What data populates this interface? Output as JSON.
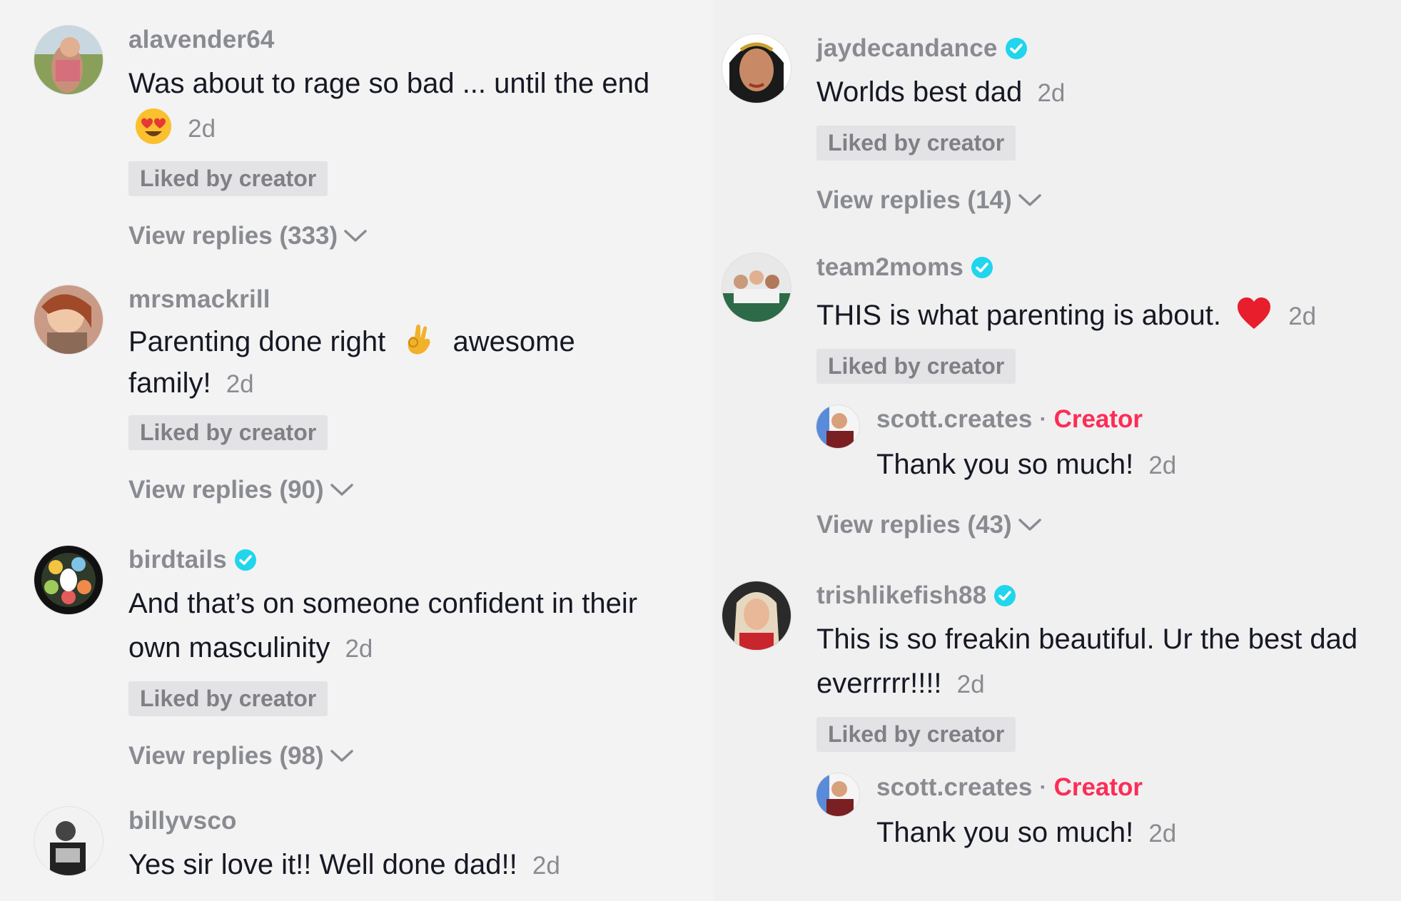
{
  "colors": {
    "verified": "#20d5ec",
    "creator_red": "#fe2c55",
    "muted": "#8a8b91"
  },
  "left": [
    {
      "username": "alavender64",
      "verified": false,
      "text": "Was about to rage so bad ... until the end",
      "emoji": "heart-eyes-emoji",
      "time": "2d",
      "liked": "Liked by creator",
      "replies": "View replies (333)"
    },
    {
      "username": "mrsmackrill",
      "verified": false,
      "text_before": "Parenting done right",
      "emoji": "ok-hand-emoji",
      "text_after": "awesome family!",
      "time": "2d",
      "liked": "Liked by creator",
      "replies": "View replies (90)"
    },
    {
      "username": "birdtails",
      "verified": true,
      "text": "And that’s on someone confident in their own masculinity",
      "time": "2d",
      "liked": "Liked by creator",
      "replies": "View replies (98)"
    },
    {
      "username": "billyvsco",
      "verified": false,
      "text": "Yes sir love it!! Well done dad!!",
      "time": "2d"
    }
  ],
  "right": [
    {
      "username": "jaydecandance",
      "verified": true,
      "text": "Worlds best dad",
      "time": "2d",
      "liked": "Liked by creator",
      "replies": "View replies (14)"
    },
    {
      "username": "team2moms",
      "verified": true,
      "text": "THIS is what parenting is about.",
      "emoji": "red-heart-emoji",
      "time": "2d",
      "liked": "Liked by creator",
      "reply": {
        "username": "scott.creates",
        "badge": "Creator",
        "separator": "·",
        "text": "Thank you so much!",
        "time": "2d"
      },
      "replies": "View replies (43)"
    },
    {
      "username": "trishlikefish88",
      "verified": true,
      "text": "This is so freakin beautiful. Ur the best dad everrrrr!!!!",
      "time": "2d",
      "liked": "Liked by creator",
      "reply": {
        "username": "scott.creates",
        "badge": "Creator",
        "separator": "·",
        "text": "Thank you so much!",
        "time": "2d"
      }
    }
  ]
}
